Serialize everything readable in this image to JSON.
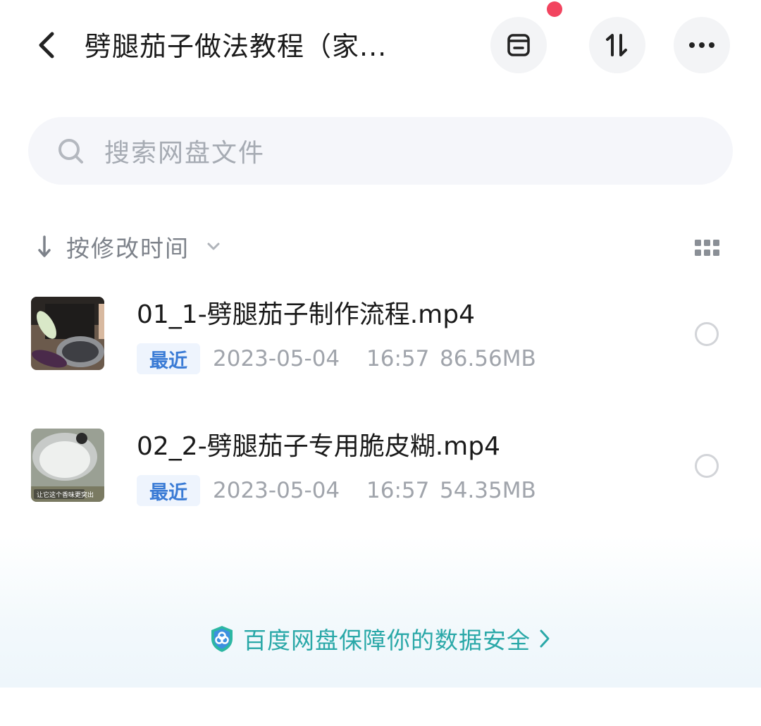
{
  "header": {
    "title": "劈腿茄子做法教程（家...",
    "icons": [
      "back-arrow",
      "box-icon",
      "sort-icon",
      "more-icon"
    ]
  },
  "search": {
    "placeholder": "搜索网盘文件"
  },
  "sort": {
    "label": "按修改时间"
  },
  "files": [
    {
      "name": "01_1-劈腿茄子制作流程.mp4",
      "badge": "最近",
      "date": "2023-05-04",
      "time": "16:57",
      "size": "86.56MB"
    },
    {
      "name": "02_2-劈腿茄子专用脆皮糊.mp4",
      "badge": "最近",
      "date": "2023-05-04",
      "time": "16:57",
      "size": "54.35MB",
      "thumb_caption": "让它这个香味更突出"
    }
  ],
  "footer": {
    "security_text": "百度网盘保障你的数据安全"
  },
  "colors": {
    "accent_blue": "#3a7bd5",
    "badge_bg": "#eef4fd",
    "security_teal": "#2aa8a8",
    "notification_red": "#f2445f",
    "muted_text": "#a0a4ab"
  }
}
